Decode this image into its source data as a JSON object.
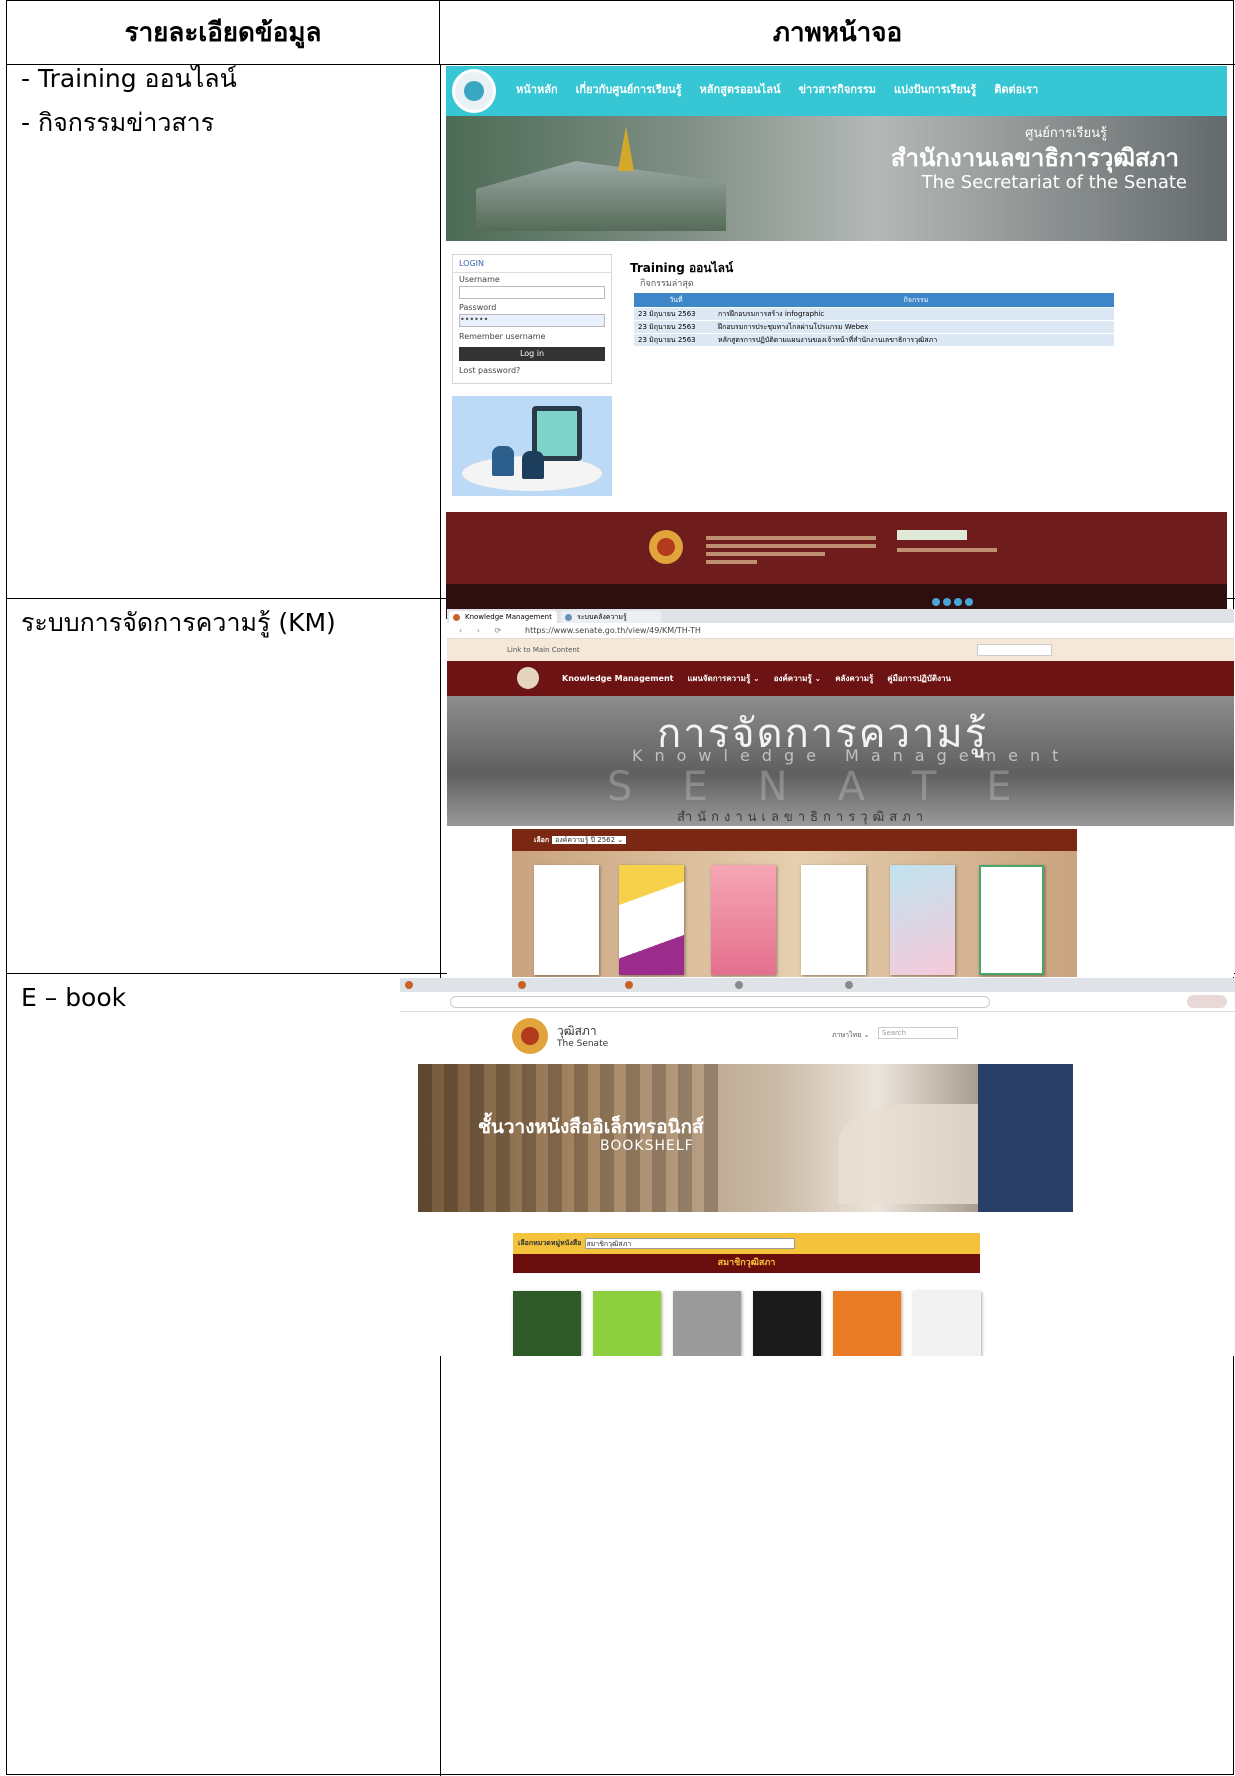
{
  "table": {
    "header_left": "รายละเอียดข้อมูล",
    "header_right": "ภาพหน้าจอ",
    "rows": [
      {
        "lines": [
          "- Training  ออนไลน์",
          "- กิจกรรมข่าวสาร"
        ]
      },
      {
        "lines": [
          "ระบบการจัดการความรู้ (KM)"
        ]
      },
      {
        "lines": [
          "E – book"
        ]
      }
    ]
  },
  "shot1": {
    "nav": [
      "หน้าหลัก",
      "เกี่ยวกับศูนย์การเรียนรู้",
      "หลักสูตรออนไลน์",
      "ข่าวสารกิจกรรม",
      "แบ่งปันการเรียนรู้",
      "ติดต่อเรา"
    ],
    "banner_small": "ศูนย์การเรียนรู้",
    "banner_big": "สำนักงานเลขาธิการวุฒิสภา",
    "banner_en": "The Secretariat of the Senate",
    "login": {
      "title": "LOGIN",
      "username_label": "Username",
      "password_label": "Password",
      "password_value": "••••••",
      "remember": "Remember username",
      "button": "Log in",
      "lost": "Lost password?"
    },
    "training_title": "Training ออนไลน์",
    "activity_title": "กิจกรรมล่าสุด",
    "table_head": [
      "วันที่",
      "กิจกรรม"
    ],
    "table_rows": [
      {
        "date": "23 มิถุนายน 2563",
        "activity": "การฝึกอบรมการสร้าง infographic"
      },
      {
        "date": "23 มิถุนายน 2563",
        "activity": "ฝึกอบรมการประชุมทางไกลผ่านโปรแกรม Webex"
      },
      {
        "date": "23 มิถุนายน 2563",
        "activity": "หลักสูตรการปฏิบัติตามแผนงานของเจ้าหน้าที่สำนักงานเลขาธิการวุฒิสภา"
      }
    ]
  },
  "shot2": {
    "tab1": "Knowledge Management",
    "tab2": "ระบบคลังความรู้",
    "url": "https://www.senate.go.th/view/49/KM/TH-TH",
    "skip": "Link to Main Content",
    "menu": [
      "Knowledge Management",
      "แผนจัดการความรู้ ⌄",
      "องค์ความรู้ ⌄",
      "คลังความรู้",
      "คู่มือการปฏิบัติงาน"
    ],
    "hero_th": "การจัดการความรู้",
    "hero_en": "Knowledge Management",
    "hero_big": "SENATE",
    "hero_sub": "สำนักงานเลขาธิการวุฒิสภา",
    "select_label": "เลือก",
    "select_value": "องค์ความรู้ ปี 2562 ⌄"
  },
  "shot3": {
    "name_th": "วุฒิสภา",
    "name_en": "The Senate",
    "lang": "ภาษาไทย ⌄",
    "search": "Search",
    "hero_th": "ชั้นวางหนังสืออิเล็กทรอนิกส์",
    "hero_en": "BOOKSHELF",
    "select_label": "เลือกหมวดหมู่หนังสือ",
    "select_value": "สมาชิกวุฒิสภา",
    "band": "สมาชิกวุฒิสภา"
  },
  "colors": {
    "teal": "#36c6d4",
    "maroon": "#6d1313",
    "blue": "#3d86c8",
    "gold": "#f5c33b"
  }
}
